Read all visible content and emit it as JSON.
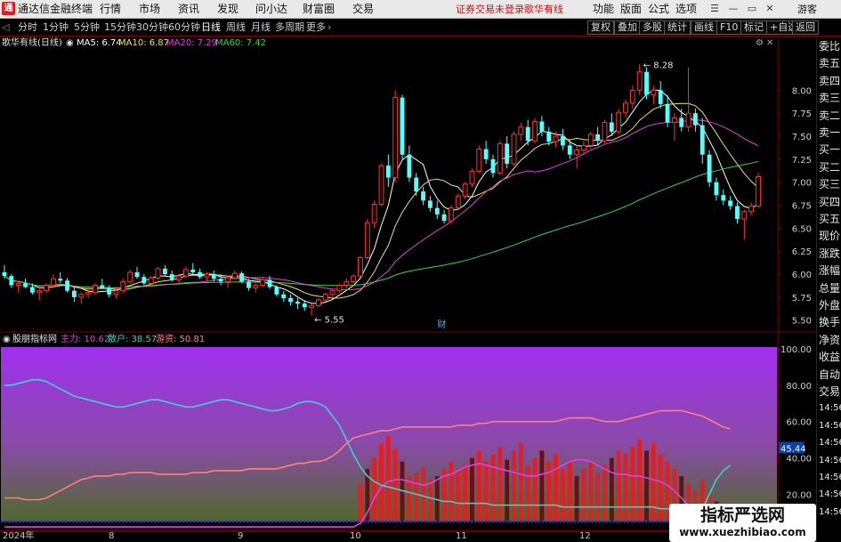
{
  "menubar": {
    "app_title": "通达信金融终端",
    "items": [
      "行情",
      "市场",
      "资讯",
      "发现",
      "问小达",
      "财富圈",
      "交易"
    ],
    "warning": "证券交易未登录",
    "stock_name": "歌华有线",
    "right_items": [
      "功能",
      "版面",
      "公式",
      "选项"
    ],
    "guest": "游客"
  },
  "tabs": [
    "分时",
    "1分钟",
    "5分钟",
    "15分钟",
    "30分钟",
    "60分钟",
    "日线",
    "周线",
    "月线",
    "多周期",
    "更多"
  ],
  "active_tab": "日线",
  "right_buttons": [
    "复权",
    "叠加",
    "多股",
    "统计",
    "画线",
    "F10",
    "标记",
    "+自选",
    "返回"
  ],
  "main_legend": {
    "title": "歌华有线(日线)",
    "ma": [
      {
        "label": "MA5: 6.74",
        "color": "#ffffff"
      },
      {
        "label": "MA10: 6.87",
        "color": "#f0e060"
      },
      {
        "label": "MA20: 7.29",
        "color": "#e040e0"
      },
      {
        "label": "MA60: 7.42",
        "color": "#40d040"
      }
    ]
  },
  "sub_legend": {
    "title": "股朋指标网",
    "items": [
      {
        "label": "主力: 10.62",
        "color": "#e040e0"
      },
      {
        "label": "散户: 38.57",
        "color": "#40d0d0"
      },
      {
        "label": "游资: 50.81",
        "color": "#ff8080"
      }
    ]
  },
  "sidebar": [
    "委比",
    "卖五",
    "卖四",
    "卖三",
    "卖二",
    "卖一",
    "买一",
    "买二",
    "买三",
    "买四",
    "买五",
    "现价",
    "涨跌",
    "涨幅",
    "总量",
    "外盘",
    "换手",
    "净资",
    "收益",
    "自动",
    "交易",
    "14:56",
    "14:56",
    "14:56",
    "14:56",
    "14:56",
    "14:56",
    "14:56"
  ],
  "x_labels": [
    "2024年",
    "8",
    "9",
    "10",
    "11",
    "12"
  ],
  "watermark": {
    "title": "指标严选网",
    "url": "www.xuezhibiao.com"
  },
  "chart_data": [
    {
      "type": "candlestick",
      "title": "歌华有线(日线)",
      "y_ticks": [
        5.5,
        5.75,
        6.0,
        6.25,
        6.5,
        6.75,
        7.0,
        7.25,
        7.5,
        7.75,
        8.0
      ],
      "ylim": [
        5.42,
        8.42
      ],
      "annotations": [
        {
          "label": "8.28",
          "value": 8.28
        },
        {
          "label": "5.55",
          "value": 5.55
        },
        {
          "label": "财",
          "value": null
        }
      ],
      "candles_ohlc": [
        [
          6.02,
          6.1,
          5.95,
          5.98
        ],
        [
          5.98,
          6.0,
          5.85,
          5.88
        ],
        [
          5.88,
          5.92,
          5.8,
          5.9
        ],
        [
          5.9,
          5.95,
          5.85,
          5.86
        ],
        [
          5.86,
          5.9,
          5.78,
          5.8
        ],
        [
          5.8,
          5.84,
          5.72,
          5.82
        ],
        [
          5.82,
          5.9,
          5.8,
          5.88
        ],
        [
          5.88,
          6.0,
          5.85,
          5.95
        ],
        [
          5.95,
          6.02,
          5.9,
          5.93
        ],
        [
          5.93,
          5.96,
          5.8,
          5.82
        ],
        [
          5.82,
          5.86,
          5.7,
          5.75
        ],
        [
          5.75,
          5.8,
          5.68,
          5.78
        ],
        [
          5.78,
          5.85,
          5.74,
          5.8
        ],
        [
          5.8,
          5.9,
          5.78,
          5.88
        ],
        [
          5.88,
          5.95,
          5.84,
          5.85
        ],
        [
          5.85,
          5.88,
          5.75,
          5.78
        ],
        [
          5.78,
          5.84,
          5.74,
          5.82
        ],
        [
          5.82,
          5.95,
          5.8,
          5.92
        ],
        [
          5.92,
          6.05,
          5.9,
          6.02
        ],
        [
          6.02,
          6.08,
          5.95,
          5.97
        ],
        [
          5.97,
          6.0,
          5.88,
          5.9
        ],
        [
          5.9,
          5.98,
          5.86,
          5.96
        ],
        [
          5.96,
          6.08,
          5.94,
          6.06
        ],
        [
          6.06,
          6.1,
          5.98,
          6.0
        ],
        [
          6.0,
          6.04,
          5.92,
          5.94
        ],
        [
          5.94,
          6.0,
          5.9,
          5.98
        ],
        [
          5.98,
          6.08,
          5.96,
          6.05
        ],
        [
          6.05,
          6.12,
          6.0,
          6.02
        ],
        [
          6.02,
          6.06,
          5.95,
          5.97
        ],
        [
          5.97,
          6.02,
          5.92,
          6.0
        ],
        [
          6.0,
          6.04,
          5.92,
          5.95
        ],
        [
          5.95,
          6.0,
          5.88,
          5.92
        ],
        [
          5.92,
          5.98,
          5.85,
          5.96
        ],
        [
          5.96,
          6.04,
          5.94,
          6.01
        ],
        [
          6.01,
          6.03,
          5.9,
          5.92
        ],
        [
          5.92,
          5.95,
          5.82,
          5.85
        ],
        [
          5.85,
          5.9,
          5.8,
          5.88
        ],
        [
          5.88,
          5.96,
          5.86,
          5.94
        ],
        [
          5.94,
          5.98,
          5.84,
          5.86
        ],
        [
          5.86,
          5.88,
          5.76,
          5.78
        ],
        [
          5.78,
          5.82,
          5.7,
          5.74
        ],
        [
          5.74,
          5.78,
          5.66,
          5.7
        ],
        [
          5.7,
          5.74,
          5.62,
          5.68
        ],
        [
          5.68,
          5.72,
          5.6,
          5.64
        ],
        [
          5.64,
          5.68,
          5.55,
          5.66
        ],
        [
          5.66,
          5.74,
          5.64,
          5.72
        ],
        [
          5.72,
          5.8,
          5.7,
          5.78
        ],
        [
          5.78,
          5.84,
          5.74,
          5.82
        ],
        [
          5.82,
          5.9,
          5.8,
          5.88
        ],
        [
          5.88,
          5.96,
          5.84,
          5.92
        ],
        [
          5.92,
          6.0,
          5.9,
          5.98
        ],
        [
          5.98,
          6.2,
          5.96,
          6.18
        ],
        [
          6.18,
          6.6,
          6.16,
          6.56
        ],
        [
          6.56,
          6.8,
          6.5,
          6.76
        ],
        [
          6.76,
          7.2,
          6.74,
          7.18
        ],
        [
          7.18,
          7.3,
          6.95,
          7.05
        ],
        [
          7.05,
          8.0,
          7.0,
          7.92
        ],
        [
          7.92,
          7.95,
          7.25,
          7.3
        ],
        [
          7.3,
          7.4,
          7.0,
          7.05
        ],
        [
          7.05,
          7.1,
          6.85,
          6.9
        ],
        [
          6.9,
          6.95,
          6.75,
          6.8
        ],
        [
          6.8,
          6.85,
          6.68,
          6.72
        ],
        [
          6.72,
          6.8,
          6.6,
          6.65
        ],
        [
          6.65,
          6.7,
          6.55,
          6.58
        ],
        [
          6.58,
          6.75,
          6.55,
          6.72
        ],
        [
          6.72,
          6.88,
          6.7,
          6.85
        ],
        [
          6.85,
          7.0,
          6.82,
          6.98
        ],
        [
          6.98,
          7.15,
          6.95,
          7.12
        ],
        [
          7.12,
          7.4,
          7.1,
          7.36
        ],
        [
          7.36,
          7.45,
          7.2,
          7.25
        ],
        [
          7.25,
          7.3,
          7.05,
          7.1
        ],
        [
          7.1,
          7.45,
          7.08,
          7.42
        ],
        [
          7.42,
          7.5,
          7.15,
          7.2
        ],
        [
          7.2,
          7.55,
          7.18,
          7.52
        ],
        [
          7.52,
          7.65,
          7.45,
          7.6
        ],
        [
          7.6,
          7.68,
          7.4,
          7.45
        ],
        [
          7.45,
          7.7,
          7.42,
          7.66
        ],
        [
          7.66,
          7.72,
          7.5,
          7.55
        ],
        [
          7.55,
          7.6,
          7.4,
          7.44
        ],
        [
          7.44,
          7.55,
          7.38,
          7.5
        ],
        [
          7.5,
          7.58,
          7.35,
          7.4
        ],
        [
          7.4,
          7.46,
          7.25,
          7.3
        ],
        [
          7.3,
          7.4,
          7.15,
          7.35
        ],
        [
          7.35,
          7.45,
          7.3,
          7.4
        ],
        [
          7.4,
          7.55,
          7.36,
          7.52
        ],
        [
          7.52,
          7.6,
          7.4,
          7.45
        ],
        [
          7.45,
          7.68,
          7.42,
          7.65
        ],
        [
          7.65,
          7.75,
          7.5,
          7.55
        ],
        [
          7.55,
          7.8,
          7.52,
          7.76
        ],
        [
          7.76,
          7.9,
          7.7,
          7.86
        ],
        [
          7.86,
          8.05,
          7.8,
          8.0
        ],
        [
          8.0,
          8.28,
          7.95,
          8.2
        ],
        [
          8.2,
          8.25,
          7.9,
          7.95
        ],
        [
          7.95,
          8.05,
          7.85,
          8.0
        ],
        [
          8.0,
          8.1,
          7.8,
          7.85
        ],
        [
          7.85,
          7.95,
          7.6,
          7.65
        ],
        [
          7.65,
          7.75,
          7.45,
          7.7
        ],
        [
          7.7,
          7.8,
          7.55,
          7.6
        ],
        [
          7.6,
          8.25,
          7.55,
          7.75
        ],
        [
          7.75,
          7.8,
          7.55,
          7.62
        ],
        [
          7.62,
          7.7,
          7.2,
          7.3
        ],
        [
          7.3,
          7.35,
          6.95,
          7.0
        ],
        [
          7.0,
          7.05,
          6.8,
          6.86
        ],
        [
          6.86,
          6.92,
          6.75,
          6.8
        ],
        [
          6.8,
          6.85,
          6.7,
          6.74
        ],
        [
          6.74,
          6.78,
          6.55,
          6.6
        ],
        [
          6.6,
          6.7,
          6.38,
          6.68
        ],
        [
          6.68,
          6.78,
          6.64,
          6.74
        ],
        [
          6.74,
          7.1,
          6.72,
          7.06
        ]
      ]
    },
    {
      "type": "line",
      "title": "股朋指标网",
      "y_ticks": [
        20,
        40,
        60,
        80,
        100
      ],
      "ylim": [
        5,
        100
      ],
      "right_label": "45.44",
      "series": [
        {
          "name": "主力",
          "color": "#e040e0",
          "values": [
            2,
            2,
            2,
            2,
            2,
            2,
            2,
            2,
            2,
            2,
            2,
            2,
            2,
            2,
            2,
            2,
            2,
            2,
            2,
            2,
            2,
            2,
            2,
            2,
            2,
            2,
            2,
            2,
            2,
            2,
            2,
            2,
            2,
            2,
            2,
            2,
            2,
            2,
            2,
            2,
            2,
            2,
            2,
            2,
            2,
            2,
            2,
            2,
            2,
            2,
            2,
            4,
            10,
            18,
            24,
            27,
            28,
            28,
            27,
            26,
            25,
            26,
            28,
            30,
            31,
            33,
            35,
            36,
            37,
            36,
            35,
            34,
            33,
            32,
            31,
            30,
            30,
            31,
            32,
            34,
            36,
            38,
            39,
            39,
            38,
            36,
            34,
            32,
            31,
            31,
            30,
            30,
            29,
            28,
            27,
            25,
            22,
            18,
            14,
            11,
            8,
            6,
            4,
            4,
            5
          ]
        },
        {
          "name": "散户",
          "color": "#40d0d0",
          "values": [
            80,
            80,
            81,
            82,
            83,
            83,
            82,
            80,
            78,
            76,
            74,
            73,
            72,
            71,
            70,
            69,
            68,
            68,
            69,
            70,
            71,
            72,
            72,
            71,
            70,
            69,
            68,
            68,
            69,
            70,
            71,
            72,
            72,
            71,
            70,
            69,
            68,
            67,
            66,
            66,
            67,
            68,
            70,
            71,
            71,
            70,
            68,
            63,
            58,
            50,
            42,
            35,
            30,
            27,
            25,
            24,
            23,
            22,
            21,
            20,
            19,
            18,
            17,
            16,
            16,
            15,
            15,
            15,
            15,
            15,
            14,
            14,
            14,
            14,
            14,
            14,
            14,
            14,
            14,
            14,
            13,
            13,
            13,
            13,
            13,
            13,
            13,
            13,
            13,
            13,
            13,
            13,
            13,
            13,
            12,
            12,
            12,
            12,
            12,
            12,
            12,
            20,
            28,
            33,
            36
          ]
        },
        {
          "name": "游资",
          "color": "#ff8080",
          "values": [
            18,
            18,
            18,
            17,
            17,
            17,
            18,
            20,
            22,
            24,
            26,
            28,
            29,
            30,
            30,
            30,
            31,
            31,
            32,
            32,
            32,
            32,
            31,
            31,
            31,
            31,
            31,
            32,
            32,
            32,
            33,
            33,
            33,
            33,
            33,
            34,
            34,
            34,
            34,
            34,
            35,
            36,
            37,
            37,
            38,
            38,
            39,
            41,
            44,
            48,
            51,
            52,
            53,
            54,
            55,
            55,
            56,
            57,
            57,
            57,
            57,
            57,
            57,
            57,
            57,
            58,
            58,
            58,
            59,
            59,
            60,
            60,
            60,
            60,
            60,
            60,
            60,
            60,
            60,
            60,
            61,
            62,
            62,
            62,
            62,
            61,
            60,
            60,
            60,
            61,
            62,
            63,
            64,
            65,
            66,
            66,
            66,
            66,
            65,
            64,
            63,
            61,
            59,
            57,
            56
          ]
        }
      ],
      "bars": [
        0,
        0,
        0,
        0,
        0,
        0,
        0,
        0,
        0,
        0,
        0,
        0,
        0,
        0,
        0,
        0,
        0,
        0,
        0,
        0,
        0,
        0,
        0,
        0,
        0,
        0,
        0,
        0,
        0,
        0,
        0,
        0,
        0,
        0,
        0,
        0,
        0,
        0,
        0,
        0,
        0,
        0,
        0,
        0,
        0,
        0,
        0,
        0,
        0,
        0,
        0,
        26,
        34,
        40,
        48,
        52,
        45,
        38,
        30,
        32,
        35,
        28,
        30,
        34,
        38,
        33,
        36,
        40,
        44,
        38,
        42,
        46,
        39,
        44,
        48,
        36,
        40,
        44,
        38,
        42,
        34,
        38,
        30,
        34,
        38,
        32,
        36,
        40,
        44,
        42,
        46,
        50,
        44,
        48,
        42,
        38,
        34,
        30,
        26,
        22,
        28,
        20,
        16,
        12,
        8
      ]
    }
  ]
}
